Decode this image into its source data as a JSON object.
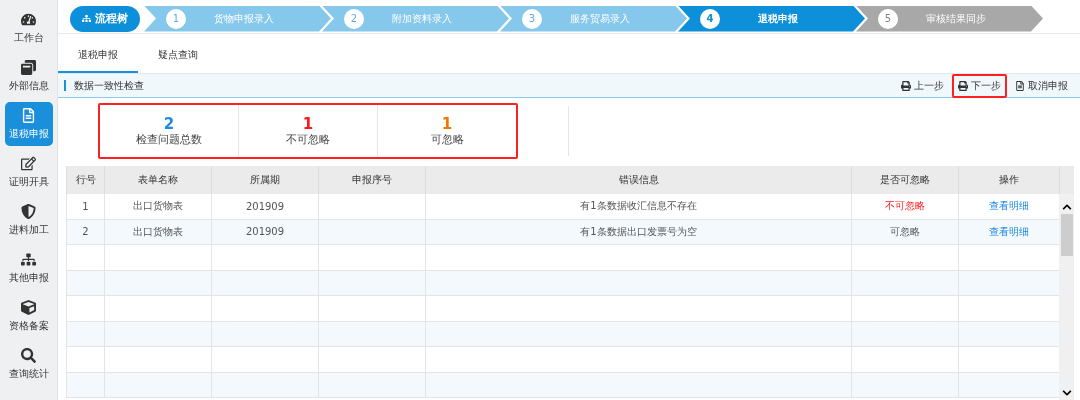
{
  "sidebar": {
    "items": [
      {
        "label": "工作台",
        "selected": false
      },
      {
        "label": "外部信息",
        "selected": false
      },
      {
        "label": "退税申报",
        "selected": true
      },
      {
        "label": "证明开具",
        "selected": false
      },
      {
        "label": "进料加工",
        "selected": false
      },
      {
        "label": "其他申报",
        "selected": false
      },
      {
        "label": "资格备案",
        "selected": false
      },
      {
        "label": "查询统计",
        "selected": false
      }
    ]
  },
  "steps": {
    "root": "流程树",
    "items": [
      {
        "number": "1",
        "label": "货物申报录入",
        "kind": "done"
      },
      {
        "number": "2",
        "label": "附加资料录入",
        "kind": "done"
      },
      {
        "number": "3",
        "label": "服务贸易录入",
        "kind": "done"
      },
      {
        "number": "4",
        "label": "退税申报",
        "kind": "current"
      },
      {
        "number": "5",
        "label": "审核结果同步",
        "kind": "pending"
      }
    ]
  },
  "tabs": [
    {
      "label": "退税申报",
      "selected": true
    },
    {
      "label": "疑点查询",
      "selected": false
    }
  ],
  "section": {
    "title": "数据一致性检查",
    "actions": [
      {
        "label": "上一步",
        "kind": "print",
        "highlighted": false
      },
      {
        "label": "下一步",
        "kind": "print",
        "highlighted": true
      },
      {
        "label": "取消申报",
        "kind": "document",
        "highlighted": false
      }
    ]
  },
  "summary": {
    "highlighted": true,
    "items": [
      {
        "value": "2",
        "label": "检查问题总数",
        "color": "#1e88e5"
      },
      {
        "value": "1",
        "label": "不可忽略",
        "color": "#ff1a1a"
      },
      {
        "value": "1",
        "label": "可忽略",
        "color": "#f07800"
      }
    ]
  },
  "table": {
    "columns": [
      "行号",
      "表单名称",
      "所属期",
      "申报序号",
      "错误信息",
      "是否可忽略",
      "操作"
    ],
    "rows": [
      {
        "index": "1",
        "form": "出口货物表",
        "period": "201909",
        "serial": "",
        "error": "有1条数据收汇信息不存在",
        "ignorable": false,
        "ignorable_text": "不可忽略",
        "action": "查看明细"
      },
      {
        "index": "2",
        "form": "出口货物表",
        "period": "201909",
        "serial": "",
        "error": "有1条数据出口发票号为空",
        "ignorable": true,
        "ignorable_text": "可忽略",
        "action": "查看明细"
      }
    ]
  }
}
